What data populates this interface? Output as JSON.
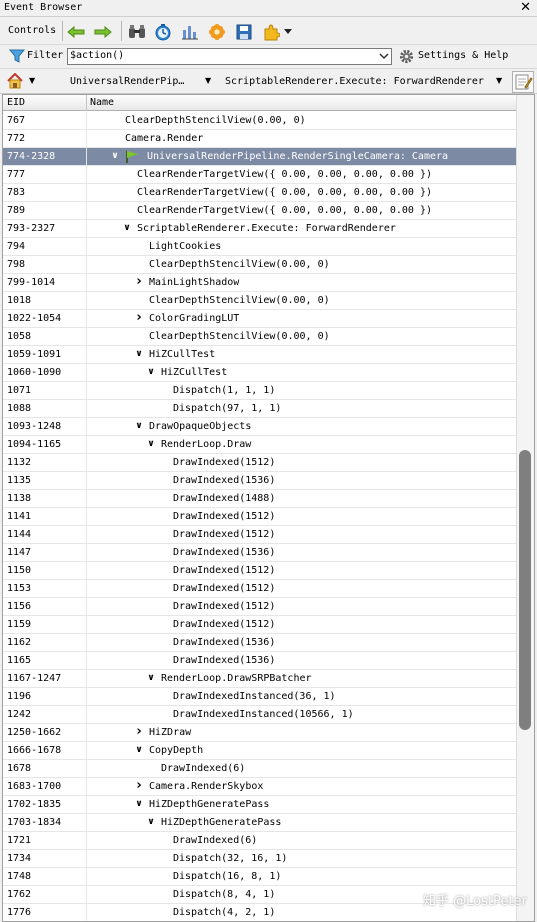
{
  "window": {
    "title": "Event Browser",
    "close_glyph": "✕"
  },
  "toolbar": {
    "controls_label": "Controls",
    "icons": [
      "arrow-left-icon",
      "arrow-right-icon",
      "binoculars-icon",
      "timer-icon",
      "bar-chart-icon",
      "flower-icon",
      "save-icon",
      "puzzle-icon"
    ]
  },
  "filter": {
    "label": "Filter",
    "value": "$action()",
    "settings_label": "Settings & Help"
  },
  "breadcrumb": {
    "items": [
      "UniversalRenderPip…",
      "ScriptableRenderer.Execute: ForwardRenderer"
    ]
  },
  "columns": {
    "eid": "EID",
    "name": "Name"
  },
  "colors": {
    "selected_row": "#7d8aa4",
    "flag": "#7cc42b",
    "arrow": "#6fb52b",
    "scroll_thumb": "#7f7f7f"
  },
  "rows": [
    {
      "eid": "767",
      "name": "ClearDepthStencilView(0.00, 0)",
      "depth": 3,
      "toggle": ""
    },
    {
      "eid": "772",
      "name": "Camera.Render",
      "depth": 3,
      "toggle": ""
    },
    {
      "eid": "774-2328",
      "name": "UniversalRenderPipeline.RenderSingleCamera: Camera",
      "depth": 3,
      "toggle": "open",
      "selected": true,
      "flag": true
    },
    {
      "eid": "777",
      "name": "ClearRenderTargetView({ 0.00, 0.00, 0.00, 0.00 })",
      "depth": 4,
      "toggle": ""
    },
    {
      "eid": "783",
      "name": "ClearRenderTargetView({ 0.00, 0.00, 0.00, 0.00 })",
      "depth": 4,
      "toggle": ""
    },
    {
      "eid": "789",
      "name": "ClearRenderTargetView({ 0.00, 0.00, 0.00, 0.00 })",
      "depth": 4,
      "toggle": ""
    },
    {
      "eid": "793-2327",
      "name": "ScriptableRenderer.Execute: ForwardRenderer",
      "depth": 4,
      "toggle": "open"
    },
    {
      "eid": "794",
      "name": "LightCookies",
      "depth": 5,
      "toggle": ""
    },
    {
      "eid": "798",
      "name": "ClearDepthStencilView(0.00, 0)",
      "depth": 5,
      "toggle": ""
    },
    {
      "eid": "799-1014",
      "name": "MainLightShadow",
      "depth": 5,
      "toggle": "closed"
    },
    {
      "eid": "1018",
      "name": "ClearDepthStencilView(0.00, 0)",
      "depth": 5,
      "toggle": ""
    },
    {
      "eid": "1022-1054",
      "name": "ColorGradingLUT",
      "depth": 5,
      "toggle": "closed"
    },
    {
      "eid": "1058",
      "name": "ClearDepthStencilView(0.00, 0)",
      "depth": 5,
      "toggle": ""
    },
    {
      "eid": "1059-1091",
      "name": "HiZCullTest",
      "depth": 5,
      "toggle": "open"
    },
    {
      "eid": "1060-1090",
      "name": "HiZCullTest",
      "depth": 6,
      "toggle": "open"
    },
    {
      "eid": "1071",
      "name": "Dispatch(1, 1, 1)",
      "depth": 7,
      "toggle": ""
    },
    {
      "eid": "1088",
      "name": "Dispatch(97, 1, 1)",
      "depth": 7,
      "toggle": ""
    },
    {
      "eid": "1093-1248",
      "name": "DrawOpaqueObjects",
      "depth": 5,
      "toggle": "open"
    },
    {
      "eid": "1094-1165",
      "name": "RenderLoop.Draw",
      "depth": 6,
      "toggle": "open"
    },
    {
      "eid": "1132",
      "name": "DrawIndexed(1512)",
      "depth": 7,
      "toggle": ""
    },
    {
      "eid": "1135",
      "name": "DrawIndexed(1536)",
      "depth": 7,
      "toggle": ""
    },
    {
      "eid": "1138",
      "name": "DrawIndexed(1488)",
      "depth": 7,
      "toggle": ""
    },
    {
      "eid": "1141",
      "name": "DrawIndexed(1512)",
      "depth": 7,
      "toggle": ""
    },
    {
      "eid": "1144",
      "name": "DrawIndexed(1512)",
      "depth": 7,
      "toggle": ""
    },
    {
      "eid": "1147",
      "name": "DrawIndexed(1536)",
      "depth": 7,
      "toggle": ""
    },
    {
      "eid": "1150",
      "name": "DrawIndexed(1512)",
      "depth": 7,
      "toggle": ""
    },
    {
      "eid": "1153",
      "name": "DrawIndexed(1512)",
      "depth": 7,
      "toggle": ""
    },
    {
      "eid": "1156",
      "name": "DrawIndexed(1512)",
      "depth": 7,
      "toggle": ""
    },
    {
      "eid": "1159",
      "name": "DrawIndexed(1512)",
      "depth": 7,
      "toggle": ""
    },
    {
      "eid": "1162",
      "name": "DrawIndexed(1536)",
      "depth": 7,
      "toggle": ""
    },
    {
      "eid": "1165",
      "name": "DrawIndexed(1536)",
      "depth": 7,
      "toggle": ""
    },
    {
      "eid": "1167-1247",
      "name": "RenderLoop.DrawSRPBatcher",
      "depth": 6,
      "toggle": "open"
    },
    {
      "eid": "1196",
      "name": "DrawIndexedInstanced(36, 1)",
      "depth": 7,
      "toggle": ""
    },
    {
      "eid": "1242",
      "name": "DrawIndexedInstanced(10566, 1)",
      "depth": 7,
      "toggle": ""
    },
    {
      "eid": "1250-1662",
      "name": "HiZDraw",
      "depth": 5,
      "toggle": "closed"
    },
    {
      "eid": "1666-1678",
      "name": "CopyDepth",
      "depth": 5,
      "toggle": "open"
    },
    {
      "eid": "1678",
      "name": "DrawIndexed(6)",
      "depth": 6,
      "toggle": ""
    },
    {
      "eid": "1683-1700",
      "name": "Camera.RenderSkybox",
      "depth": 5,
      "toggle": "closed"
    },
    {
      "eid": "1702-1835",
      "name": "HiZDepthGeneratePass",
      "depth": 5,
      "toggle": "open"
    },
    {
      "eid": "1703-1834",
      "name": "HiZDepthGeneratePass",
      "depth": 6,
      "toggle": "open"
    },
    {
      "eid": "1721",
      "name": "DrawIndexed(6)",
      "depth": 7,
      "toggle": ""
    },
    {
      "eid": "1734",
      "name": "Dispatch(32, 16, 1)",
      "depth": 7,
      "toggle": ""
    },
    {
      "eid": "1748",
      "name": "Dispatch(16, 8, 1)",
      "depth": 7,
      "toggle": ""
    },
    {
      "eid": "1762",
      "name": "Dispatch(8, 4, 1)",
      "depth": 7,
      "toggle": ""
    },
    {
      "eid": "1776",
      "name": "Dispatch(4, 2, 1)",
      "depth": 7,
      "toggle": ""
    }
  ],
  "watermark": "知乎 @LostPeter"
}
